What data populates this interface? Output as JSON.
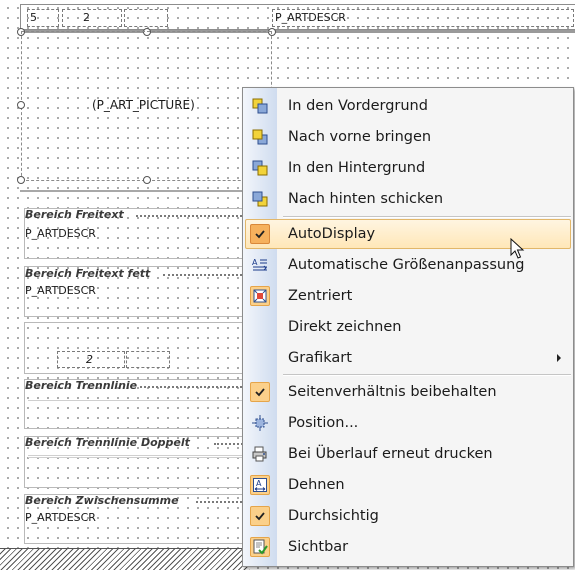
{
  "canvas": {
    "header_field_number": "5",
    "header_field_page": "2",
    "header_field_descr": "P_ARTDESCR",
    "picture_field": "(P_ART_PICTURE)",
    "bands": [
      {
        "title": "Bereich Freitext",
        "field": "P_ARTDESCR"
      },
      {
        "title": "Bereich Freitext fett",
        "field": "P_ARTDESCR"
      },
      {
        "title": "",
        "field": "2"
      },
      {
        "title": "Bereich Trennlinie",
        "field": ""
      },
      {
        "title": "Bereich Trennlinie Doppelt",
        "field": ""
      },
      {
        "title": "Bereich Zwischensumme",
        "field": "P_ARTDESCR"
      }
    ]
  },
  "context_menu": {
    "items": [
      {
        "label": "In den Vordergrund",
        "icon": "bring-to-front-icon",
        "checked": false
      },
      {
        "label": "Nach vorne bringen",
        "icon": "bring-forward-icon",
        "checked": false
      },
      {
        "label": "In den Hintergrund",
        "icon": "send-to-back-icon",
        "checked": false
      },
      {
        "label": "Nach hinten schicken",
        "icon": "send-backward-icon",
        "checked": false
      },
      {
        "label": "AutoDisplay",
        "icon": "check-icon",
        "checked": true,
        "highlighted": true
      },
      {
        "label": "Automatische Größenanpassung",
        "icon": "auto-size-icon",
        "checked": false
      },
      {
        "label": "Zentriert",
        "icon": "center-icon",
        "checked": true
      },
      {
        "label": "Direkt zeichnen",
        "icon": "",
        "checked": false
      },
      {
        "label": "Grafikart",
        "icon": "",
        "checked": false,
        "submenu": true
      },
      {
        "label": "Seitenverhältnis beibehalten",
        "icon": "check-icon",
        "checked": true
      },
      {
        "label": "Position...",
        "icon": "position-icon",
        "checked": false
      },
      {
        "label": "Bei Überlauf erneut drucken",
        "icon": "reprint-icon",
        "checked": false
      },
      {
        "label": "Dehnen",
        "icon": "stretch-icon",
        "checked": true
      },
      {
        "label": "Durchsichtig",
        "icon": "check-icon",
        "checked": true
      },
      {
        "label": "Sichtbar",
        "icon": "visible-icon",
        "checked": true
      }
    ]
  },
  "colors": {
    "highlight": "#ffe7b8",
    "check_background": "#fbd08a",
    "gutter": "#cfdcef"
  }
}
